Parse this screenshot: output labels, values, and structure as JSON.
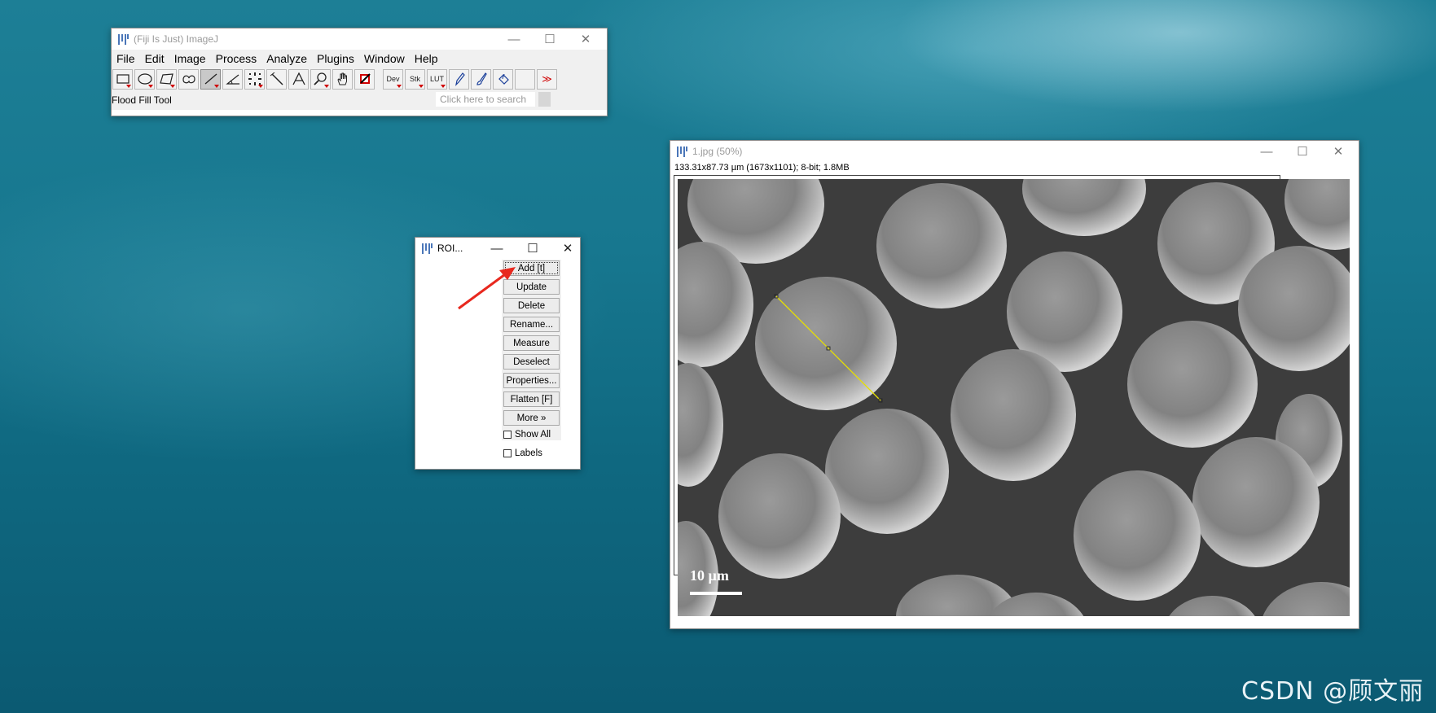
{
  "fiji": {
    "title": "(Fiji Is Just) ImageJ",
    "menu": [
      "File",
      "Edit",
      "Image",
      "Process",
      "Analyze",
      "Plugins",
      "Window",
      "Help"
    ],
    "tools": {
      "dev": "Dev",
      "stk": "Stk",
      "lut": "LUT",
      "more": "≫"
    },
    "status": "Flood Fill Tool",
    "search_placeholder": "Click here to search"
  },
  "roi_manager": {
    "title": "ROI...",
    "buttons": [
      "Add [t]",
      "Update",
      "Delete",
      "Rename...",
      "Measure",
      "Deselect",
      "Properties...",
      "Flatten [F]",
      "More »"
    ],
    "checkboxes": [
      "Show All",
      "Labels"
    ]
  },
  "image_window": {
    "title": "1.jpg (50%)",
    "info": "133.31x87.73 µm (1673x1101); 8-bit; 1.8MB",
    "scale_bar_label": "10 µm",
    "line_roi_color": "#e8e000"
  },
  "watermark": "CSDN @顾文丽"
}
